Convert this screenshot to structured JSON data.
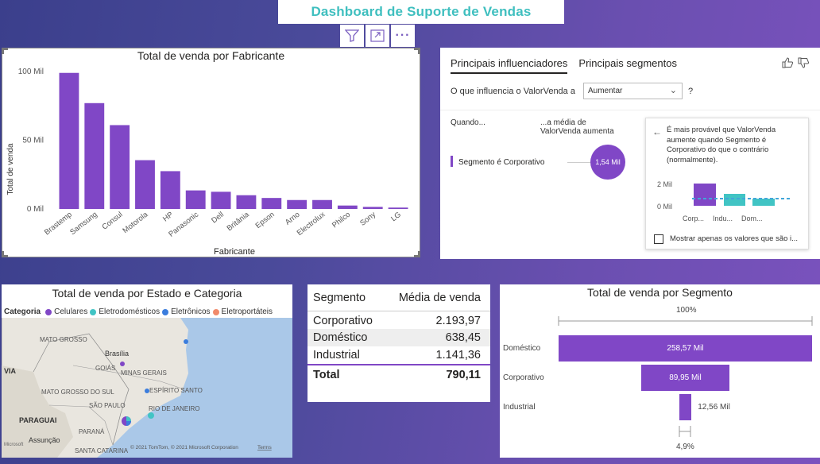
{
  "title": "Dashboard de Suporte de Vendas",
  "toolbar": {
    "filter_icon": "filter-icon",
    "focus_icon": "focus-mode-icon",
    "more_icon": "more-options-icon",
    "more_glyph": "···"
  },
  "colors": {
    "purple": "#8047c6",
    "teal": "#41c4c4",
    "title_teal": "#3fbfbf"
  },
  "bar_chart": {
    "title": "Total de venda por Fabricante",
    "xlabel": "Fabricante",
    "ylabel": "Total de venda",
    "yticks": [
      "100 Mil",
      "50 Mil",
      "0 Mil"
    ]
  },
  "chart_data": {
    "type": "bar",
    "title": "Total de venda por Fabricante",
    "xlabel": "Fabricante",
    "ylabel": "Total de venda",
    "categories": [
      "Brastemp",
      "Samsung",
      "Consul",
      "Motorola",
      "HP",
      "Panasonic",
      "Dell",
      "Britânia",
      "Epson",
      "Arno",
      "Electrolux",
      "Philco",
      "Sony",
      "LG"
    ],
    "values": [
      99,
      77,
      61,
      35.5,
      27.5,
      13.5,
      12.5,
      10,
      8,
      6.5,
      6.5,
      2.5,
      1.5,
      1
    ],
    "ylim": [
      0,
      100
    ],
    "grid": false
  },
  "influencers": {
    "tab_active": "Principais influenciadores",
    "tab_other": "Principais segmentos",
    "question": "O que influencia o ValorVenda a",
    "dropdown": "Aumentar",
    "help": "?",
    "col_when": "Quando...",
    "col_avg": "...a média de ValorVenda aumenta",
    "factor": "Segmento é Corporativo",
    "bubble": "1,54 Mil",
    "card_text": "É mais provável que ValorVenda aumente quando Segmento é Corporativo do que o contrário (normalmente).",
    "mini_y": [
      "2 Mil",
      "0 Mil"
    ],
    "mini_x": [
      "Corp...",
      "Indu...",
      "Dom..."
    ],
    "checkbox_label": "Mostrar apenas os valores que são i..."
  },
  "map": {
    "title": "Total de venda por Estado e Categoria",
    "legend_title": "Categoria",
    "legend": [
      {
        "label": "Celulares",
        "color": "#8047c6"
      },
      {
        "label": "Eletrodomésticos",
        "color": "#41c4c4"
      },
      {
        "label": "Eletrônicos",
        "color": "#3b7ddd"
      },
      {
        "label": "Eletroportáteis",
        "color": "#f08a6b"
      }
    ],
    "places": [
      "MATO GROSSO",
      "Brasília",
      "GOIÁS",
      "MINAS GERAIS",
      "ESPÍRITO SANTO",
      "MATO GROSSO DO SUL",
      "SÃO PAULO",
      "RIO DE JANEIRO",
      "PARAGUAI",
      "PARANÁ",
      "Assunção",
      "SANTA CATARINA",
      "VIA"
    ],
    "copyright": "© 2021 TomTom, © 2021 Microsoft Corporation",
    "terms": "Terms",
    "ms_logo": "Microsoft"
  },
  "table": {
    "headers": [
      "Segmento",
      "Média de venda"
    ],
    "rows": [
      [
        "Corporativo",
        "2.193,97"
      ],
      [
        "Doméstico",
        "638,45"
      ],
      [
        "Industrial",
        "1.141,36"
      ]
    ],
    "total": [
      "Total",
      "790,11"
    ]
  },
  "funnel": {
    "title": "Total de venda por Segmento",
    "top_pct": "100%",
    "bottom_pct": "4,9%",
    "stages": [
      {
        "label": "Doméstico",
        "value_label": "258,57 Mil",
        "value": 258.57
      },
      {
        "label": "Corporativo",
        "value_label": "89,95 Mil",
        "value": 89.95
      },
      {
        "label": "Industrial",
        "value_label": "12,56 Mil",
        "value": 12.56
      }
    ]
  }
}
